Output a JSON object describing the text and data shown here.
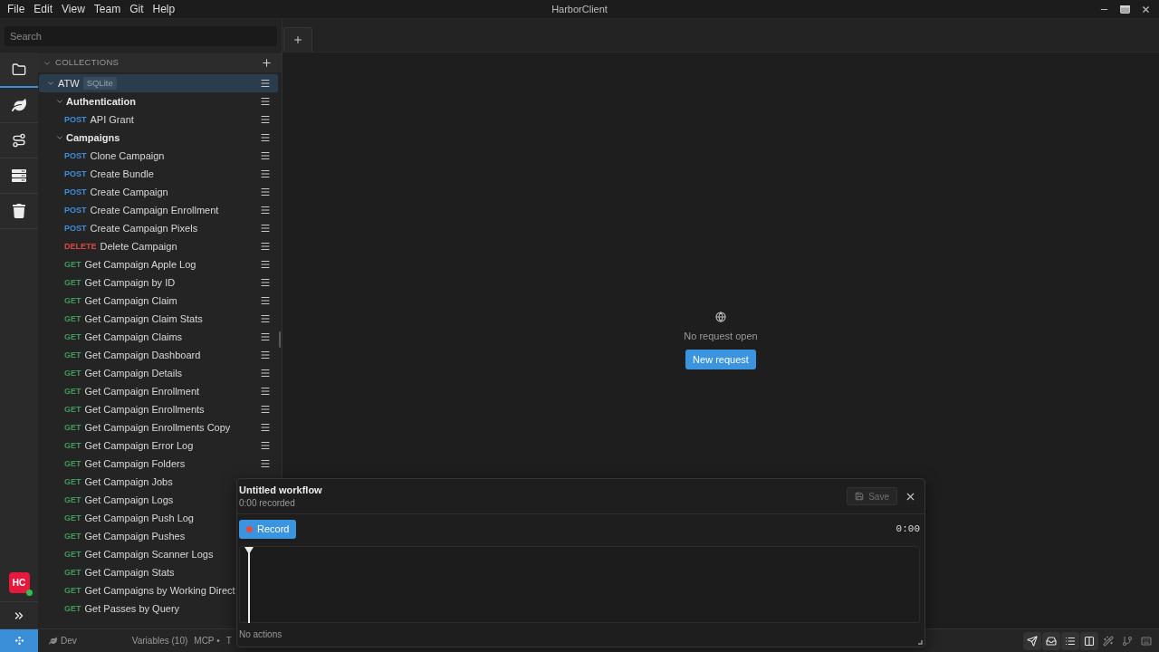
{
  "window": {
    "title": "HarborClient",
    "menu": [
      "File",
      "Edit",
      "View",
      "Team",
      "Git",
      "Help"
    ]
  },
  "search": {
    "placeholder": "Search"
  },
  "rail": {
    "items": [
      {
        "selected": true
      },
      {
        "selected": false
      },
      {
        "selected": false
      },
      {
        "selected": false
      },
      {
        "selected": false
      }
    ],
    "avatar": {
      "initials": "HC",
      "online": true
    }
  },
  "sidebar": {
    "header": "COLLECTIONS",
    "tree": [
      {
        "kind": "collection",
        "name": "ATW",
        "badge": "SQLite",
        "expanded": true,
        "selected": true,
        "menu": true,
        "children": [
          {
            "kind": "folder",
            "name": "Authentication",
            "expanded": true,
            "selected": false,
            "menu": true,
            "children": [
              {
                "kind": "request",
                "method": "POST",
                "color": "#3f8ee0",
                "name": "API Grant",
                "selected": false,
                "menu": true
              }
            ]
          },
          {
            "kind": "folder",
            "name": "Campaigns",
            "expanded": true,
            "selected": false,
            "menu": true,
            "children": [
              {
                "kind": "request",
                "method": "POST",
                "color": "#3f8ee0",
                "name": "Clone Campaign",
                "selected": false,
                "menu": true
              },
              {
                "kind": "request",
                "method": "POST",
                "color": "#3f8ee0",
                "name": "Create Bundle",
                "selected": false,
                "menu": true
              },
              {
                "kind": "request",
                "method": "POST",
                "color": "#3f8ee0",
                "name": "Create Campaign",
                "selected": false,
                "menu": true
              },
              {
                "kind": "request",
                "method": "POST",
                "color": "#3f8ee0",
                "name": "Create Campaign Enrollment",
                "selected": false,
                "menu": true
              },
              {
                "kind": "request",
                "method": "POST",
                "color": "#3f8ee0",
                "name": "Create Campaign Pixels",
                "selected": false,
                "menu": true
              },
              {
                "kind": "request",
                "method": "DELETE",
                "color": "#e0463f",
                "name": "Delete Campaign",
                "selected": false,
                "menu": true
              },
              {
                "kind": "request",
                "method": "GET",
                "color": "#3e9b5a",
                "name": "Get Campaign Apple Log",
                "selected": false,
                "menu": true
              },
              {
                "kind": "request",
                "method": "GET",
                "color": "#3e9b5a",
                "name": "Get Campaign by ID",
                "selected": false,
                "menu": true
              },
              {
                "kind": "request",
                "method": "GET",
                "color": "#3e9b5a",
                "name": "Get Campaign Claim",
                "selected": false,
                "menu": true
              },
              {
                "kind": "request",
                "method": "GET",
                "color": "#3e9b5a",
                "name": "Get Campaign Claim Stats",
                "selected": false,
                "menu": true
              },
              {
                "kind": "request",
                "method": "GET",
                "color": "#3e9b5a",
                "name": "Get Campaign Claims",
                "selected": false,
                "menu": true
              },
              {
                "kind": "request",
                "method": "GET",
                "color": "#3e9b5a",
                "name": "Get Campaign Dashboard",
                "selected": false,
                "menu": true
              },
              {
                "kind": "request",
                "method": "GET",
                "color": "#3e9b5a",
                "name": "Get Campaign Details",
                "selected": false,
                "menu": true
              },
              {
                "kind": "request",
                "method": "GET",
                "color": "#3e9b5a",
                "name": "Get Campaign Enrollment",
                "selected": false,
                "menu": true
              },
              {
                "kind": "request",
                "method": "GET",
                "color": "#3e9b5a",
                "name": "Get Campaign Enrollments",
                "selected": false,
                "menu": true
              },
              {
                "kind": "request",
                "method": "GET",
                "color": "#3e9b5a",
                "name": "Get Campaign Enrollments Copy",
                "selected": false,
                "menu": true
              },
              {
                "kind": "request",
                "method": "GET",
                "color": "#3e9b5a",
                "name": "Get Campaign Error Log",
                "selected": false,
                "menu": true
              },
              {
                "kind": "request",
                "method": "GET",
                "color": "#3e9b5a",
                "name": "Get Campaign Folders",
                "selected": false,
                "menu": true
              },
              {
                "kind": "request",
                "method": "GET",
                "color": "#3e9b5a",
                "name": "Get Campaign Jobs",
                "selected": false
              },
              {
                "kind": "request",
                "method": "GET",
                "color": "#3e9b5a",
                "name": "Get Campaign Logs",
                "selected": false
              },
              {
                "kind": "request",
                "method": "GET",
                "color": "#3e9b5a",
                "name": "Get Campaign Push Log",
                "selected": false
              },
              {
                "kind": "request",
                "method": "GET",
                "color": "#3e9b5a",
                "name": "Get Campaign Pushes",
                "selected": false
              },
              {
                "kind": "request",
                "method": "GET",
                "color": "#3e9b5a",
                "name": "Get Campaign Scanner Logs",
                "selected": false
              },
              {
                "kind": "request",
                "method": "GET",
                "color": "#3e9b5a",
                "name": "Get Campaign Stats",
                "selected": false
              },
              {
                "kind": "request",
                "method": "GET",
                "color": "#3e9b5a",
                "name": "Get Campaigns by Working Direct",
                "selected": false
              },
              {
                "kind": "request",
                "method": "GET",
                "color": "#3e9b5a",
                "name": "Get Passes by Query",
                "selected": false
              }
            ]
          }
        ]
      }
    ]
  },
  "main": {
    "message": "No request open",
    "button": "New request"
  },
  "workflow": {
    "title": "Untitled workflow",
    "subtitle": "0:00 recorded",
    "save": {
      "label": "Save",
      "disabled": true
    },
    "record": "Record",
    "timer": "0:00",
    "empty": "No actions"
  },
  "status_bar": {
    "environment": "Dev",
    "items": [
      "Variables (10)",
      "MCP •",
      "T"
    ],
    "toggles": [
      {
        "on": true
      },
      {
        "on": true
      },
      {
        "on": true
      },
      {
        "on": true
      },
      {
        "on": false
      },
      {
        "on": false
      },
      {
        "on": false
      }
    ]
  }
}
